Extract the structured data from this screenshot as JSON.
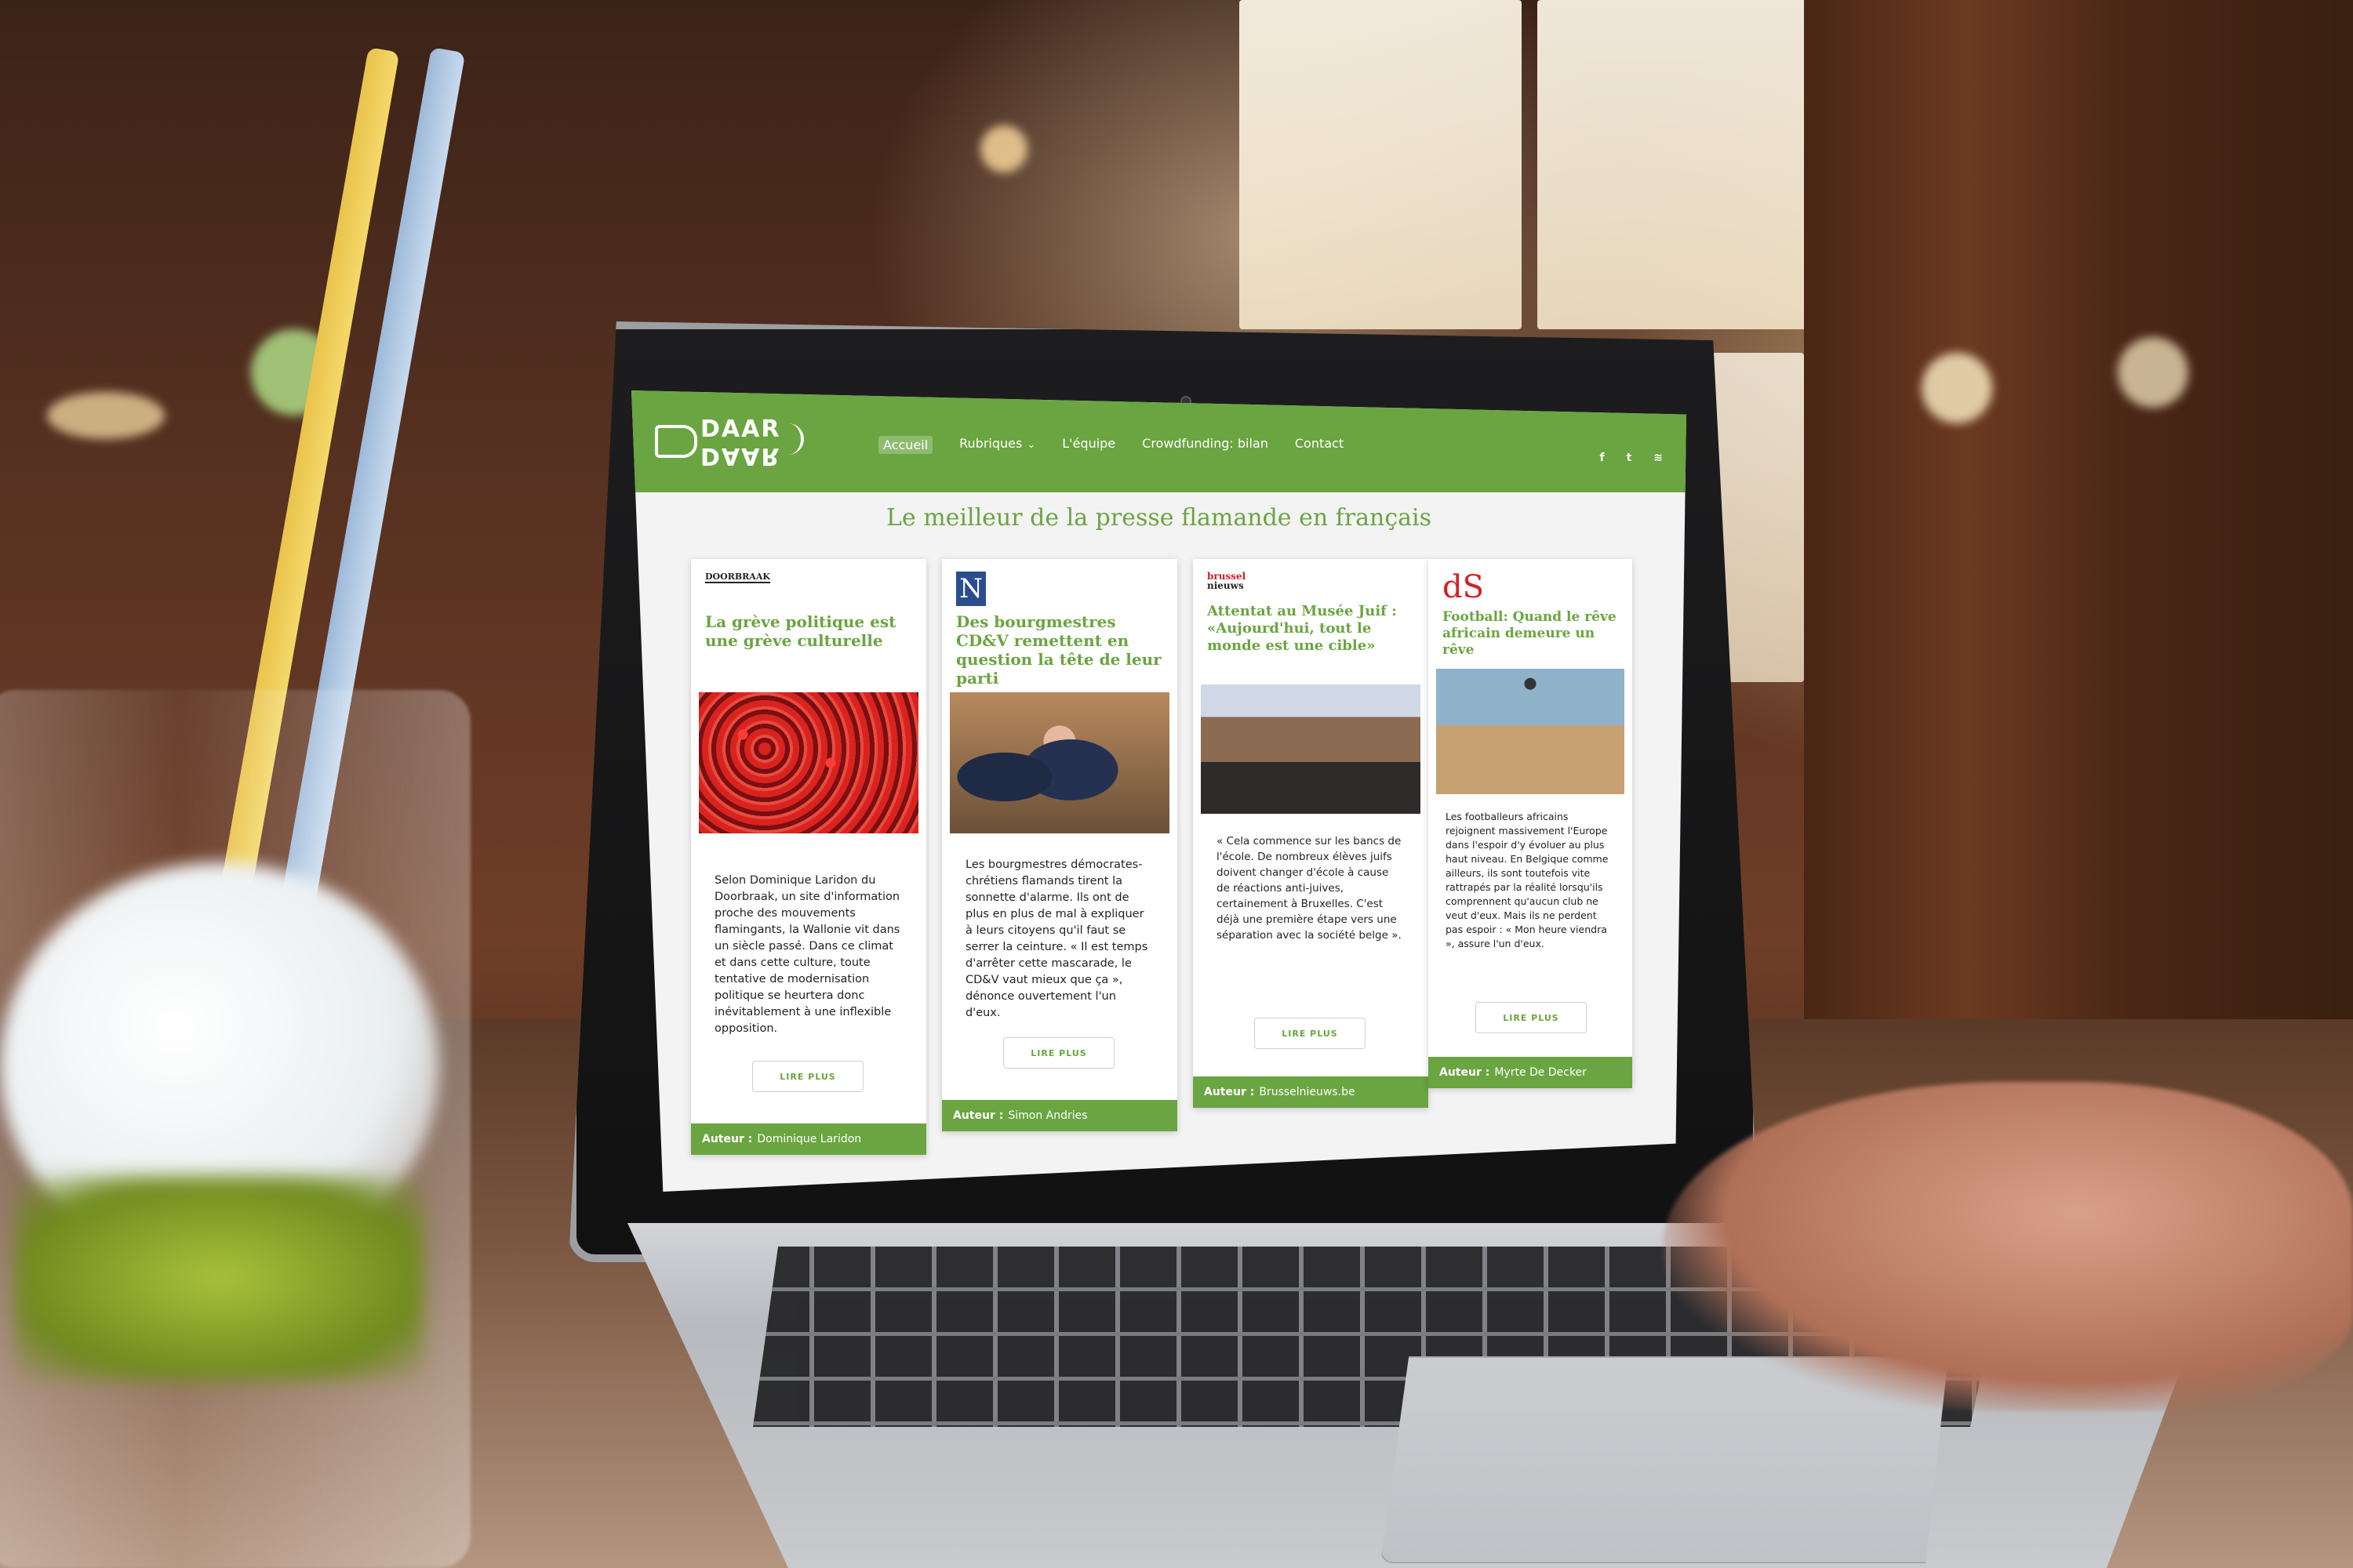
{
  "site": {
    "logo_line1": "DAAR",
    "logo_line2": "DAAR",
    "colors": {
      "brand_green": "#6aa541",
      "background": "#f3f3f3"
    }
  },
  "nav": {
    "items": [
      {
        "label": "Accueil",
        "active": true
      },
      {
        "label": "Rubriques",
        "dropdown": true
      },
      {
        "label": "L'équipe"
      },
      {
        "label": "Crowdfunding: bilan"
      },
      {
        "label": "Contact"
      }
    ],
    "social": [
      {
        "icon": "facebook-icon",
        "glyph": "f"
      },
      {
        "icon": "twitter-icon",
        "glyph": "t"
      },
      {
        "icon": "rss-icon",
        "glyph": "≋"
      }
    ]
  },
  "tagline": "Le meilleur de la presse flamande en français",
  "cards": [
    {
      "source": "DOORBRAAK",
      "title": "La grève politique est une grève culturelle",
      "image": "protest-crowd-image",
      "text": "Selon Dominique Laridon du Doorbraak, un site d'information proche des mouvements flamingants, la Wallonie vit dans un siècle passé. Dans ce climat et dans cette culture, toute tentative de modernisation politique se heurtera donc inévitablement à une inflexible opposition.",
      "button": "LIRE PLUS",
      "author_label": "Auteur :",
      "author": "Dominique Laridon"
    },
    {
      "source": "N",
      "title": "Des bourgmestres CD&V remettent en question la tête de leur parti",
      "image": "politicians-image",
      "text": "Les bourgmestres démocrates-chrétiens flamands tirent la sonnette d'alarme. Ils ont de plus en plus de mal à expliquer à leurs citoyens qu'il faut se serrer la ceinture. « Il est temps d'arrêter cette mascarade, le CD&V vaut mieux que ça », dénonce ouvertement l'un d'eux.",
      "button": "LIRE PLUS",
      "author_label": "Auteur :",
      "author": "Simon Andries"
    },
    {
      "source_line1": "brussel",
      "source_line2": "nieuws",
      "title": "Attentat au Musée Juif : «Aujourd'hui, tout le monde est une cible»",
      "image": "street-image",
      "text": "« Cela commence sur les bancs de l'école. De nombreux élèves juifs doivent changer d'école à cause de réactions anti-juives, certainement à Bruxelles. C'est déjà une première étape vers une séparation avec la société belge ».",
      "button": "LIRE PLUS",
      "author_label": "Auteur :",
      "author": "Brusselnieuws.be"
    },
    {
      "source": "dS",
      "title": "Football: Quand le rêve africain demeure un rêve",
      "image": "football-image",
      "text": "Les footballeurs africains rejoignent massivement l'Europe dans l'espoir d'y évoluer au plus haut niveau. En Belgique comme ailleurs, ils sont toutefois vite rattrapés par la réalité lorsqu'ils comprennent qu'aucun club ne veut d'eux. Mais ils ne perdent pas espoir : « Mon heure viendra », assure l'un d'eux.",
      "button": "LIRE PLUS",
      "author_label": "Auteur :",
      "author": "Myrte De Decker"
    }
  ]
}
